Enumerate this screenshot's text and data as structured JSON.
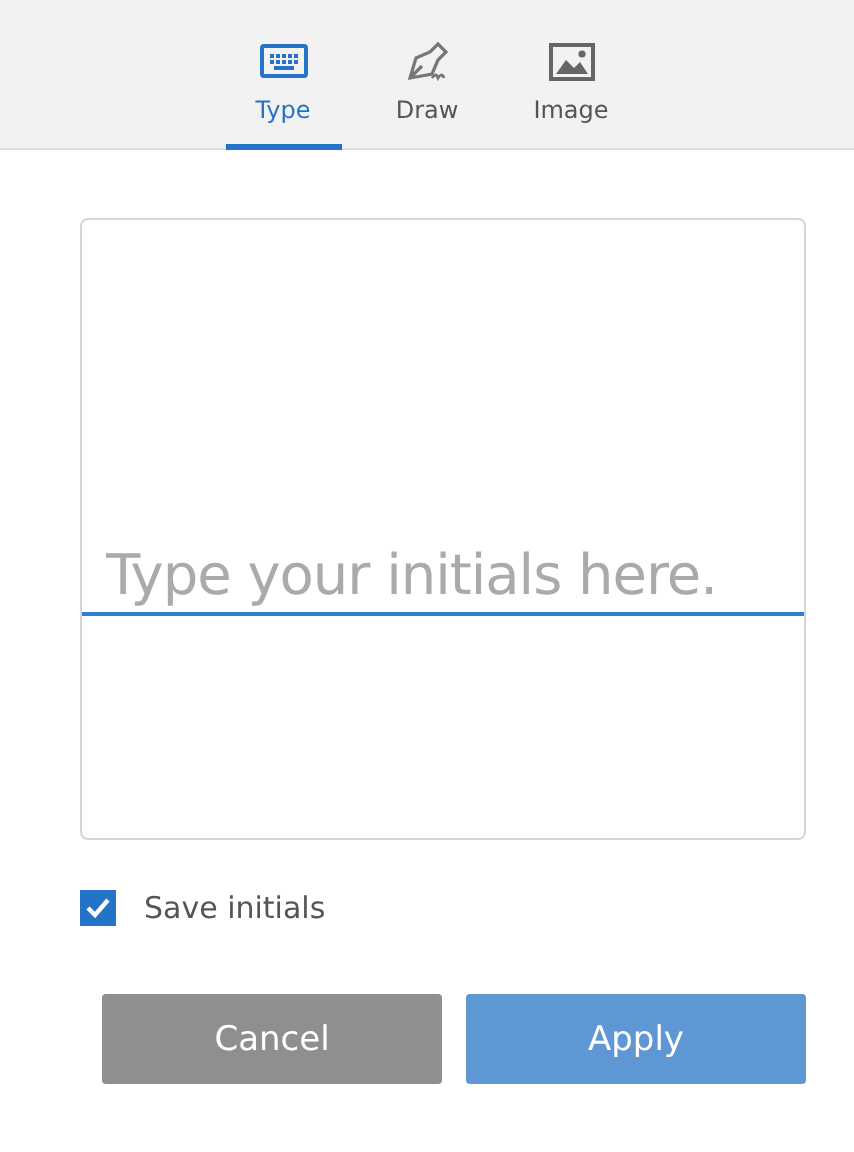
{
  "tabs": [
    {
      "kind": "keyboard",
      "label": "Type",
      "selected": true
    },
    {
      "kind": "pen",
      "label": "Draw",
      "selected": false
    },
    {
      "kind": "image",
      "label": "Image",
      "selected": false
    }
  ],
  "initials_field": {
    "placeholder": "Type your initials here."
  },
  "save_initials": {
    "label": "Save initials",
    "checked": true
  },
  "buttons": [
    {
      "label": "Cancel",
      "disabled": false
    },
    {
      "label": "Apply",
      "disabled": true
    }
  ]
}
